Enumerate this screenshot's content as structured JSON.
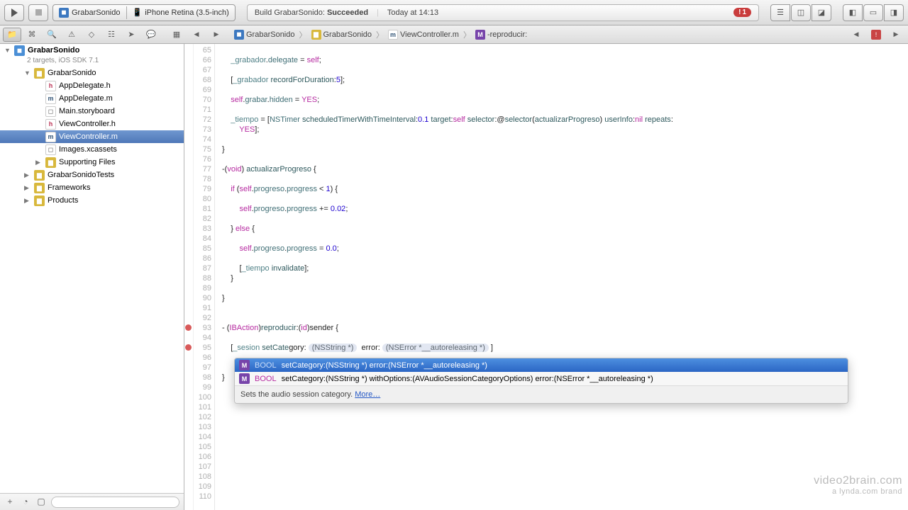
{
  "toolbar": {
    "scheme_project": "GrabarSonido",
    "scheme_device": "iPhone Retina (3.5-inch)"
  },
  "status": {
    "build_prefix": "Build GrabarSonido: ",
    "build_result": "Succeeded",
    "time": "Today at 14:13",
    "error_count": "1"
  },
  "jumpbar": {
    "project": "GrabarSonido",
    "group": "GrabarSonido",
    "file": "ViewController.m",
    "symbol": "-reproducir:"
  },
  "navigator": {
    "project_name": "GrabarSonido",
    "project_sub": "2 targets, iOS SDK 7.1",
    "items": [
      {
        "label": "GrabarSonido",
        "depth": 1,
        "icon": "folder",
        "disclosure": "▼"
      },
      {
        "label": "AppDelegate.h",
        "depth": 2,
        "icon": "h"
      },
      {
        "label": "AppDelegate.m",
        "depth": 2,
        "icon": "m"
      },
      {
        "label": "Main.storyboard",
        "depth": 2,
        "icon": "sb"
      },
      {
        "label": "ViewController.h",
        "depth": 2,
        "icon": "h"
      },
      {
        "label": "ViewController.m",
        "depth": 2,
        "icon": "m",
        "selected": true
      },
      {
        "label": "Images.xcassets",
        "depth": 2,
        "icon": "xc"
      },
      {
        "label": "Supporting Files",
        "depth": 2,
        "icon": "folder",
        "disclosure": "▶"
      },
      {
        "label": "GrabarSonidoTests",
        "depth": 1,
        "icon": "folder",
        "disclosure": "▶"
      },
      {
        "label": "Frameworks",
        "depth": 1,
        "icon": "folder",
        "disclosure": "▶"
      },
      {
        "label": "Products",
        "depth": 1,
        "icon": "folder",
        "disclosure": "▶"
      }
    ]
  },
  "gutter": {
    "start": 65,
    "end": 110
  },
  "code": {
    "lines": [
      "",
      "    _grabador.delegate = self;",
      "",
      "    [_grabador recordForDuration:5];",
      "",
      "    self.grabar.hidden = YES;",
      "",
      "    _tiempo = [NSTimer scheduledTimerWithTimeInterval:0.1 target:self selector:@selector(actualizarProgreso) userInfo:nil repeats:",
      "        YES];",
      "",
      "}",
      "",
      "-(void) actualizarProgreso {",
      "",
      "    if (self.progreso.progress < 1) {",
      "",
      "        self.progreso.progress += 0.02;",
      "",
      "    } else {",
      "",
      "        self.progreso.progress = 0.0;",
      "",
      "        [_tiempo invalidate];",
      "    }",
      "",
      "}",
      "",
      "",
      "- (IBAction)reproducir:(id)sender {",
      "",
      "    [_sesion setCategory: (NSString *)  error: (NSError *__autoreleasing *) ]",
      "",
      "",
      "}",
      "",
      "",
      "",
      "",
      "",
      "",
      "",
      "",
      "",
      "",
      "",
      ""
    ]
  },
  "autocomplete": {
    "rows": [
      {
        "ret": "BOOL",
        "sig": "setCategory:(NSString *) error:(NSError *__autoreleasing *)",
        "selected": true
      },
      {
        "ret": "BOOL",
        "sig": "setCategory:(NSString *) withOptions:(AVAudioSessionCategoryOptions) error:(NSError *__autoreleasing *)",
        "selected": false
      }
    ],
    "desc": "Sets the audio session category. ",
    "more": "More…"
  },
  "watermark": {
    "line1": "video2brain.com",
    "line2": "a lynda.com brand"
  }
}
